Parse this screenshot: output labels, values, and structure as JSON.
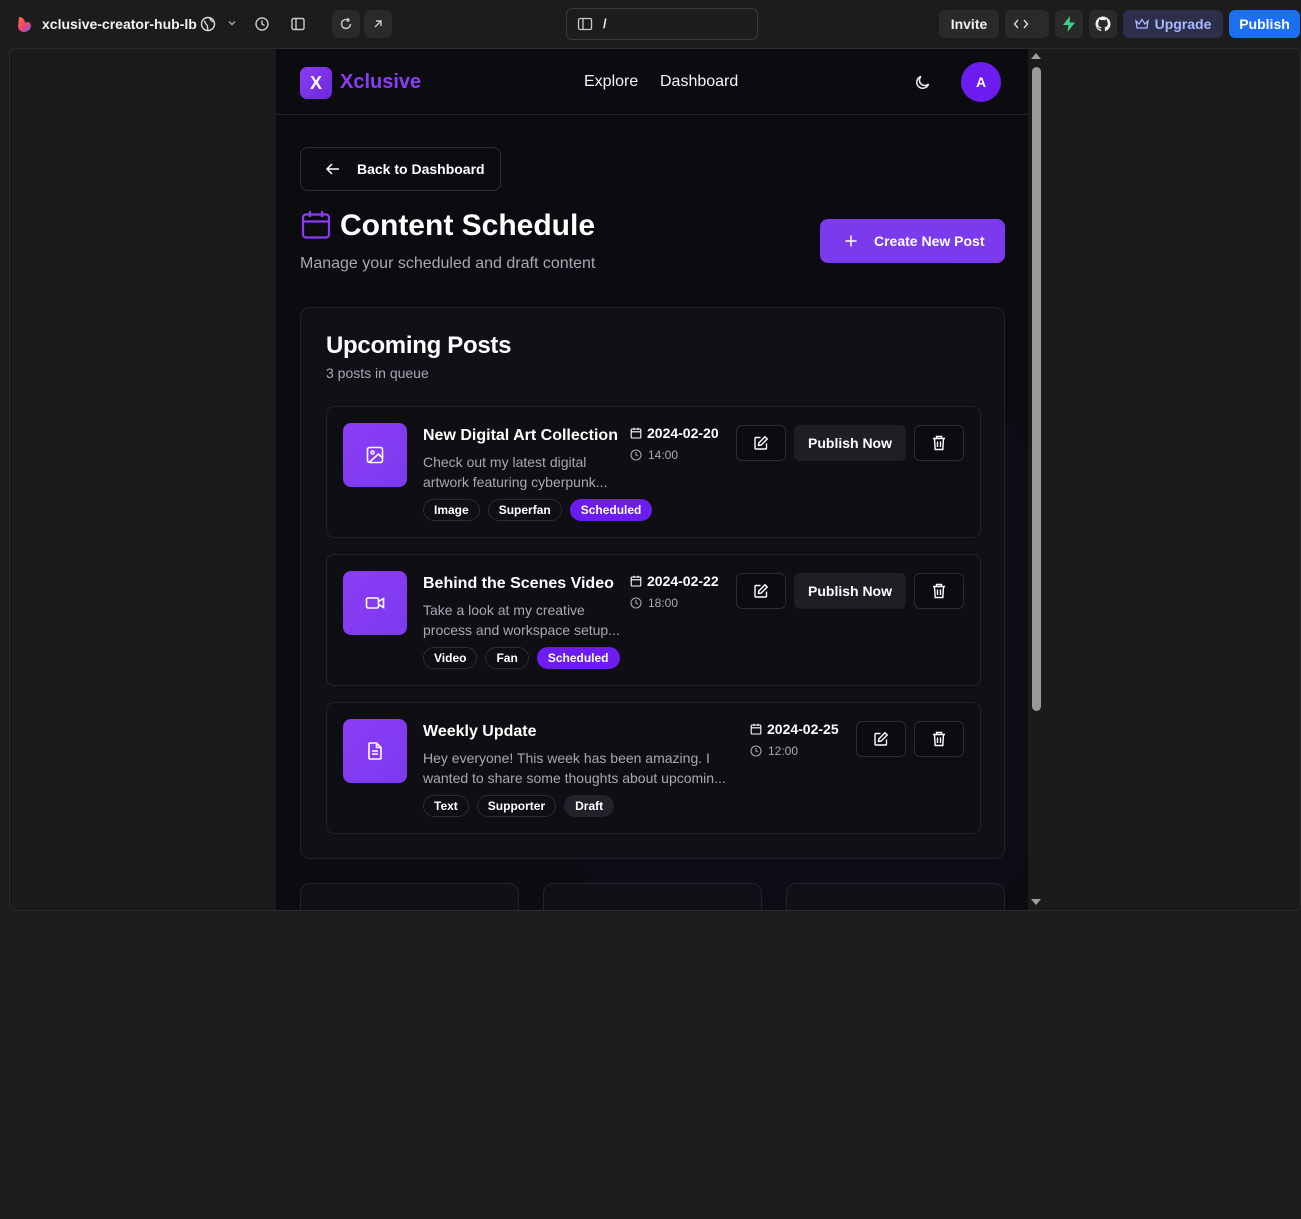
{
  "editor": {
    "project_name": "xclusive-creator-hub-lb",
    "url_path": "/",
    "invite_label": "Invite",
    "upgrade_label": "Upgrade",
    "publish_label": "Publish"
  },
  "app": {
    "brand_letter": "X",
    "brand_name": "Xclusive",
    "nav": {
      "explore": "Explore",
      "dashboard": "Dashboard"
    },
    "avatar_initial": "A",
    "back_label": "Back to Dashboard",
    "page_title": "Content Schedule",
    "page_subtitle": "Manage your scheduled and draft content",
    "create_label": "Create New Post",
    "upcoming": {
      "title": "Upcoming Posts",
      "count_text": "3 posts in queue",
      "publish_now_label": "Publish Now",
      "posts": [
        {
          "icon": "image-icon",
          "title": "New Digital Art Collection",
          "desc_line1": "Check out my latest digital",
          "desc_line2": "artwork featuring cyberpunk...",
          "date": "2024-02-20",
          "time": "14:00",
          "type": "Image",
          "tier": "Superfan",
          "status": "Scheduled"
        },
        {
          "icon": "video-icon",
          "title": "Behind the Scenes Video",
          "desc_line1": "Take a look at my creative",
          "desc_line2": "process and workspace setup...",
          "date": "2024-02-22",
          "time": "18:00",
          "type": "Video",
          "tier": "Fan",
          "status": "Scheduled"
        },
        {
          "icon": "document-icon",
          "title": "Weekly Update",
          "desc_line1": "Hey everyone! This week has been amazing. I",
          "desc_line2": "wanted to share some thoughts about upcomin...",
          "date": "2024-02-25",
          "time": "12:00",
          "type": "Text",
          "tier": "Supporter",
          "status": "Draft"
        }
      ]
    }
  },
  "colors": {
    "accent": "#7c3aed",
    "brand": "#8b3cf6",
    "editor_publish": "#1d6ff2"
  }
}
